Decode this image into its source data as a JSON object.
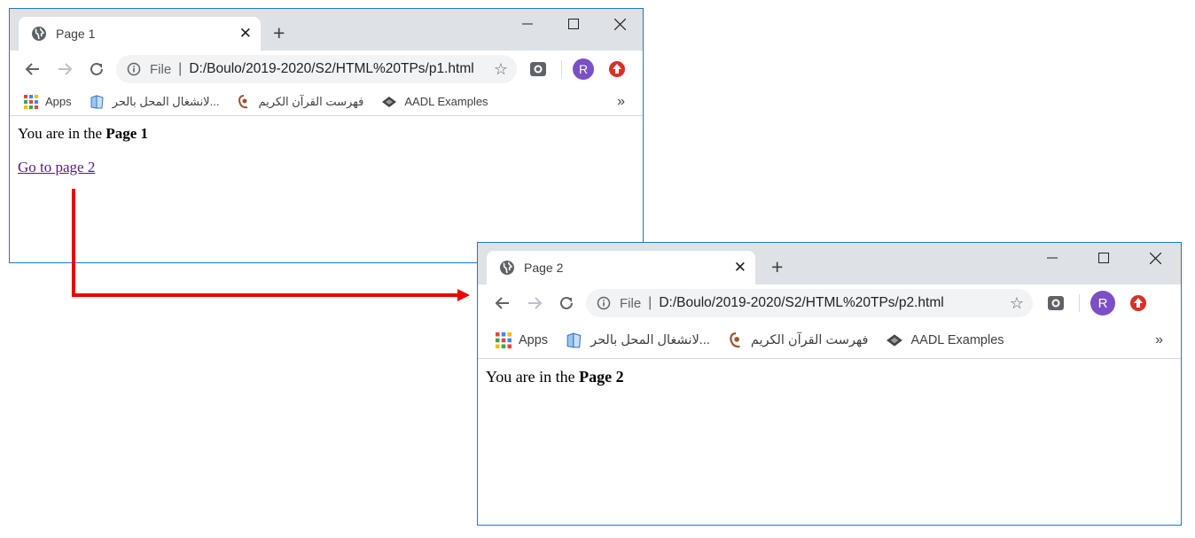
{
  "windows": [
    {
      "tab_title": "Page 1",
      "file_label": "File",
      "url": "D:/Boulo/2019-2020/S2/HTML%20TPs/p1.html",
      "avatar_letter": "R",
      "bookmarks": {
        "apps": "Apps",
        "item1": "لانشغال المحل بالحر...",
        "item2": "فهرست القرآن الكريم",
        "item3": "AADL Examples",
        "more": "»"
      },
      "content": {
        "text_prefix": "You are in the ",
        "text_bold": "Page 1",
        "link": "Go to page 2"
      }
    },
    {
      "tab_title": "Page 2",
      "file_label": "File",
      "url": "D:/Boulo/2019-2020/S2/HTML%20TPs/p2.html",
      "avatar_letter": "R",
      "bookmarks": {
        "apps": "Apps",
        "item1": "لانشغال المحل بالحر...",
        "item2": "فهرست القرآن الكريم",
        "item3": "AADL Examples",
        "more": "»"
      },
      "content": {
        "text_prefix": "You are in the ",
        "text_bold": "Page 2"
      }
    }
  ],
  "colors": {
    "arrow": "#ee0000",
    "window_border": "#1f78c8",
    "link_visited": "#551a8b",
    "avatar": "#7b4fc6",
    "update_badge": "#d93025"
  }
}
